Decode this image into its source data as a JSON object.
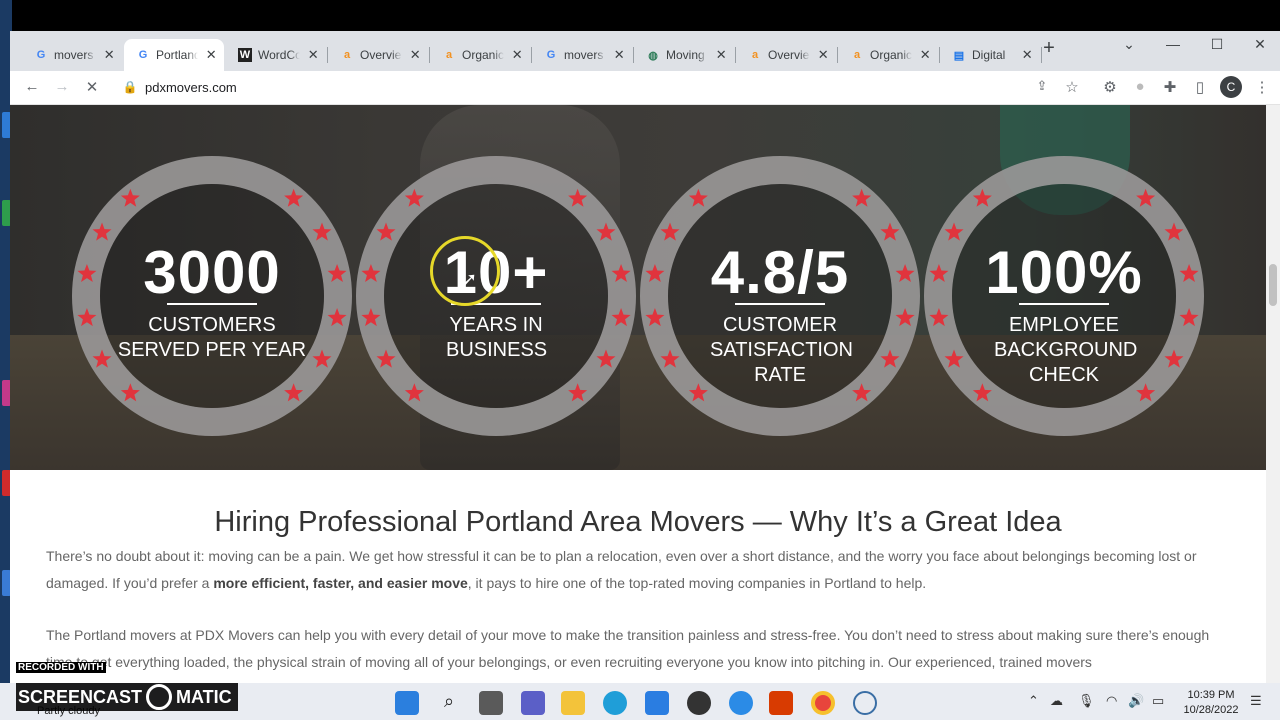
{
  "browser": {
    "tabs": [
      {
        "label": "movers",
        "icon": "google-icon"
      },
      {
        "label": "Portland",
        "icon": "google-icon",
        "active": true
      },
      {
        "label": "WordCo",
        "icon": "wordcounter-icon"
      },
      {
        "label": "Overvie",
        "icon": "ahrefs-icon"
      },
      {
        "label": "Organic",
        "icon": "ahrefs-icon"
      },
      {
        "label": "movers",
        "icon": "google-icon"
      },
      {
        "label": "Moving",
        "icon": "globe-icon"
      },
      {
        "label": "Overvie",
        "icon": "ahrefs-icon"
      },
      {
        "label": "Organic",
        "icon": "ahrefs-icon"
      },
      {
        "label": "Digital",
        "icon": "docs-icon"
      }
    ],
    "url": "pdxmovers.com",
    "profile_initial": "C"
  },
  "stats": [
    {
      "value": "3000",
      "label": "CUSTOMERS SERVED PER YEAR"
    },
    {
      "value": "10+",
      "label": "YEARS IN BUSINESS"
    },
    {
      "value": "4.8/5",
      "label": "CUSTOMER SATISFACTION RATE"
    },
    {
      "value": "100%",
      "label": "EMPLOYEE BACKGROUND CHECK"
    }
  ],
  "content": {
    "heading": "Hiring Professional Portland Area Movers — Why It’s a Great Idea",
    "p1_before": "There’s no doubt about it: moving can be a pain. We get how stressful it can be to plan a relocation, even over a short distance, and the worry you face about belongings becoming lost or damaged. If you’d prefer a ",
    "p1_bold": "more efficient, faster, and easier move",
    "p1_after": ", it pays to hire one of the top-rated moving companies in Portland to help.",
    "p2": "The Portland movers at PDX Movers can help you with every detail of your move to make the transition painless and stress-free. You don’t need to stress about making sure there’s enough time to get everything loaded, the physical strain of moving all of your belongings, or even recruiting everyone you know into pitching in. Our experienced, trained movers"
  },
  "taskbar": {
    "weather": "Partly cloudy",
    "time": "10:39 PM",
    "date": "10/28/2022"
  },
  "watermark": {
    "recorded": "RECORDED WITH",
    "brand_left": "SCREENCAST",
    "brand_right": "MATIC"
  },
  "colors": {
    "star": "#e0343d",
    "ring": "#9a9898",
    "highlight_ring": "#e6d829"
  }
}
